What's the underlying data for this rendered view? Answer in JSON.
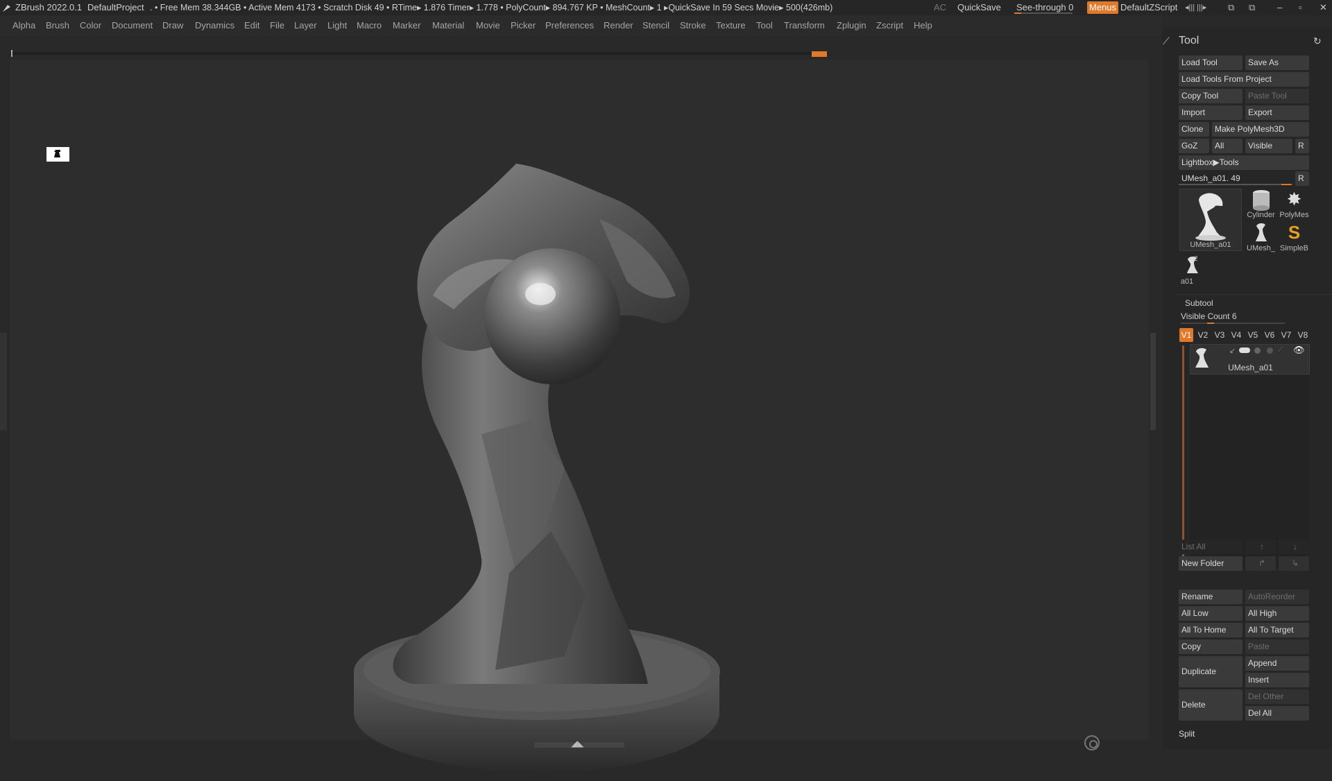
{
  "titlebar": {
    "app": "ZBrush 2022.0.1",
    "project": "DefaultProject",
    "stats": ". • Free Mem 38.344GB • Active Mem 4173 • Scratch Disk 49 •  RTime▸ 1.876 Timer▸ 1.778 • PolyCount▸ 894.767 KP  • MeshCount▸ 1  ▸QuickSave In 59 Secs Movie▸ 500(426mb)",
    "ac": "AC",
    "quicksave": "QuickSave",
    "seethrough": "See-through  0",
    "menus": "Menus",
    "script": "DefaultZScript"
  },
  "menubar": {
    "items": [
      "Alpha",
      "Brush",
      "Color",
      "Document",
      "Draw",
      "Dynamics",
      "Edit",
      "File",
      "Layer",
      "Light",
      "Macro",
      "Marker",
      "Material",
      "Movie",
      "Picker",
      "Preferences",
      "Render",
      "Stencil",
      "Stroke",
      "Texture",
      "Tool",
      "Transform",
      "Zplugin",
      "Zscript",
      "Help"
    ]
  },
  "colors": {
    "accent": "#e07a2a",
    "bg": "#292929",
    "panel": "#262626"
  },
  "tool": {
    "title": "Tool",
    "load_tool": "Load Tool",
    "save_as": "Save As",
    "load_from_project": "Load Tools From Project",
    "copy_tool": "Copy Tool",
    "paste_tool": "Paste Tool",
    "import": "Import",
    "export": "Export",
    "clone": "Clone",
    "make_polymesh": "Make PolyMesh3D",
    "goz": "GoZ",
    "all": "All",
    "visible": "Visible",
    "r": "R",
    "lightbox_tools": "Lightbox▶Tools",
    "current_tool": "UMesh_a01. 49",
    "thumbs": {
      "main": "UMesh_a01",
      "cylinder": "Cylinder",
      "polymesh": "PolyMes",
      "umesh": "UMesh_",
      "simpleb": "SimpleB",
      "a01": "a01",
      "a01_count": "2"
    }
  },
  "subtool": {
    "title": "Subtool",
    "visible_count": "Visible Count 6",
    "versions": [
      "V1",
      "V2",
      "V3",
      "V4",
      "V5",
      "V6",
      "V7",
      "V8"
    ],
    "item_name": "UMesh_a01",
    "list_all": "List All",
    "new_folder": "New Folder",
    "rename": "Rename",
    "autoreorder": "AutoReorder",
    "all_low": "All Low",
    "all_high": "All High",
    "all_to_home": "All To Home",
    "all_to_target": "All To Target",
    "copy": "Copy",
    "paste": "Paste",
    "duplicate": "Duplicate",
    "append": "Append",
    "insert": "Insert",
    "delete": "Delete",
    "del_other": "Del Other",
    "del_all": "Del All",
    "split": "Split"
  }
}
